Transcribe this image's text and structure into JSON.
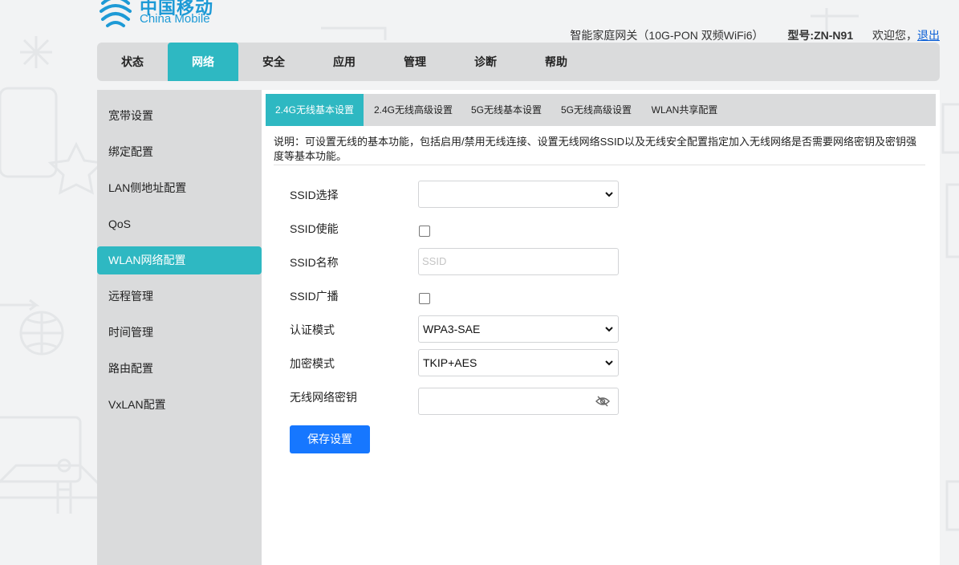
{
  "brand": {
    "logo_cn": "中国移动",
    "logo_en": "China Mobile",
    "color": "#1d9ad6"
  },
  "header": {
    "device_name": "智能家庭网关（10G-PON 双频WiFi6）",
    "model": "型号:ZN-N91",
    "welcome": "欢迎您，",
    "logout": "退出"
  },
  "nav": {
    "tabs": [
      {
        "label": "状态"
      },
      {
        "label": "网络",
        "active": true
      },
      {
        "label": "安全"
      },
      {
        "label": "应用"
      },
      {
        "label": "管理"
      },
      {
        "label": "诊断"
      },
      {
        "label": "帮助"
      }
    ]
  },
  "sidebar": {
    "items": [
      {
        "label": "宽带设置"
      },
      {
        "label": "绑定配置"
      },
      {
        "label": "LAN侧地址配置"
      },
      {
        "label": "QoS"
      },
      {
        "label": "WLAN网络配置",
        "active": true
      },
      {
        "label": "远程管理"
      },
      {
        "label": "时间管理"
      },
      {
        "label": "路由配置"
      },
      {
        "label": "VxLAN配置"
      }
    ]
  },
  "subtabs": [
    {
      "label": "2.4G无线基本设置",
      "active": true
    },
    {
      "label": "2.4G无线高级设置"
    },
    {
      "label": "5G无线基本设置"
    },
    {
      "label": "5G无线高级设置"
    },
    {
      "label": "WLAN共享配置"
    }
  ],
  "description": "说明：可设置无线的基本功能，包括启用/禁用无线连接、设置无线网络SSID以及无线安全配置指定加入无线网络是否需要网络密钥及密钥强度等基本功能。",
  "form": {
    "ssid_select": {
      "label": "SSID选择",
      "value": ""
    },
    "ssid_enable": {
      "label": "SSID使能",
      "checked": false
    },
    "ssid_name": {
      "label": "SSID名称",
      "value": "",
      "placeholder": "SSID"
    },
    "ssid_broadcast": {
      "label": "SSID广播",
      "checked": false
    },
    "auth_mode": {
      "label": "认证模式",
      "value": "WPA3-SAE"
    },
    "encryption_mode": {
      "label": "加密模式",
      "value": "TKIP+AES"
    },
    "wireless_key": {
      "label": "无线网络密钥",
      "value": ""
    },
    "save_label": "保存设置"
  },
  "colors": {
    "accent": "#2eb8c2",
    "button": "#1677ff",
    "panel": "#dadbdc"
  }
}
